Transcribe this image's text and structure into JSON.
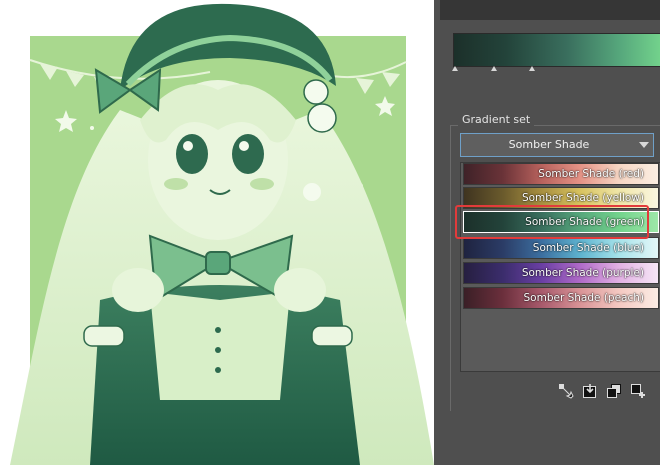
{
  "gradient_set": {
    "legend": "Gradient set",
    "selected": "Somber Shade",
    "items": [
      {
        "label": "Somber Shade (red)",
        "selected": false,
        "colors": [
          "#3f2228",
          "#6a3338",
          "#b8625d",
          "#e59386",
          "#f6d6c4",
          "#fbeee2"
        ]
      },
      {
        "label": "Somber Shade (yellow)",
        "selected": false,
        "colors": [
          "#3f3420",
          "#6a5a2c",
          "#a88f40",
          "#d8c35f",
          "#f0e6a8",
          "#faf6e0"
        ]
      },
      {
        "label": "Somber Shade (green)",
        "selected": true,
        "colors": [
          "#1c302a",
          "#23433a",
          "#3a6f5e",
          "#56a77c",
          "#73d38c",
          "#9ee7a8"
        ]
      },
      {
        "label": "Somber Shade (blue)",
        "selected": false,
        "colors": [
          "#1f2340",
          "#2b3c66",
          "#3c6fa0",
          "#5eb3cf",
          "#a7e3ea",
          "#e4f7f8"
        ]
      },
      {
        "label": "Somber Shade (purple)",
        "selected": false,
        "colors": [
          "#261f40",
          "#3b2d6c",
          "#6a3fa3",
          "#b06bc8",
          "#e2b1e3",
          "#f6e6f6"
        ]
      },
      {
        "label": "Somber Shade (peach)",
        "selected": false,
        "colors": [
          "#3a1f26",
          "#6b2f3c",
          "#a85a6c",
          "#d99497",
          "#f4c9c2",
          "#fbece4"
        ]
      }
    ]
  },
  "toolbar": {
    "icons": [
      "edit-gradient-icon",
      "import-gradient-icon",
      "duplicate-gradient-icon",
      "add-gradient-icon"
    ]
  },
  "colors": {
    "panel_bg": "#4f4f4f",
    "selection_outline": "#e23b3b",
    "art_tint": "#a9d88e"
  }
}
